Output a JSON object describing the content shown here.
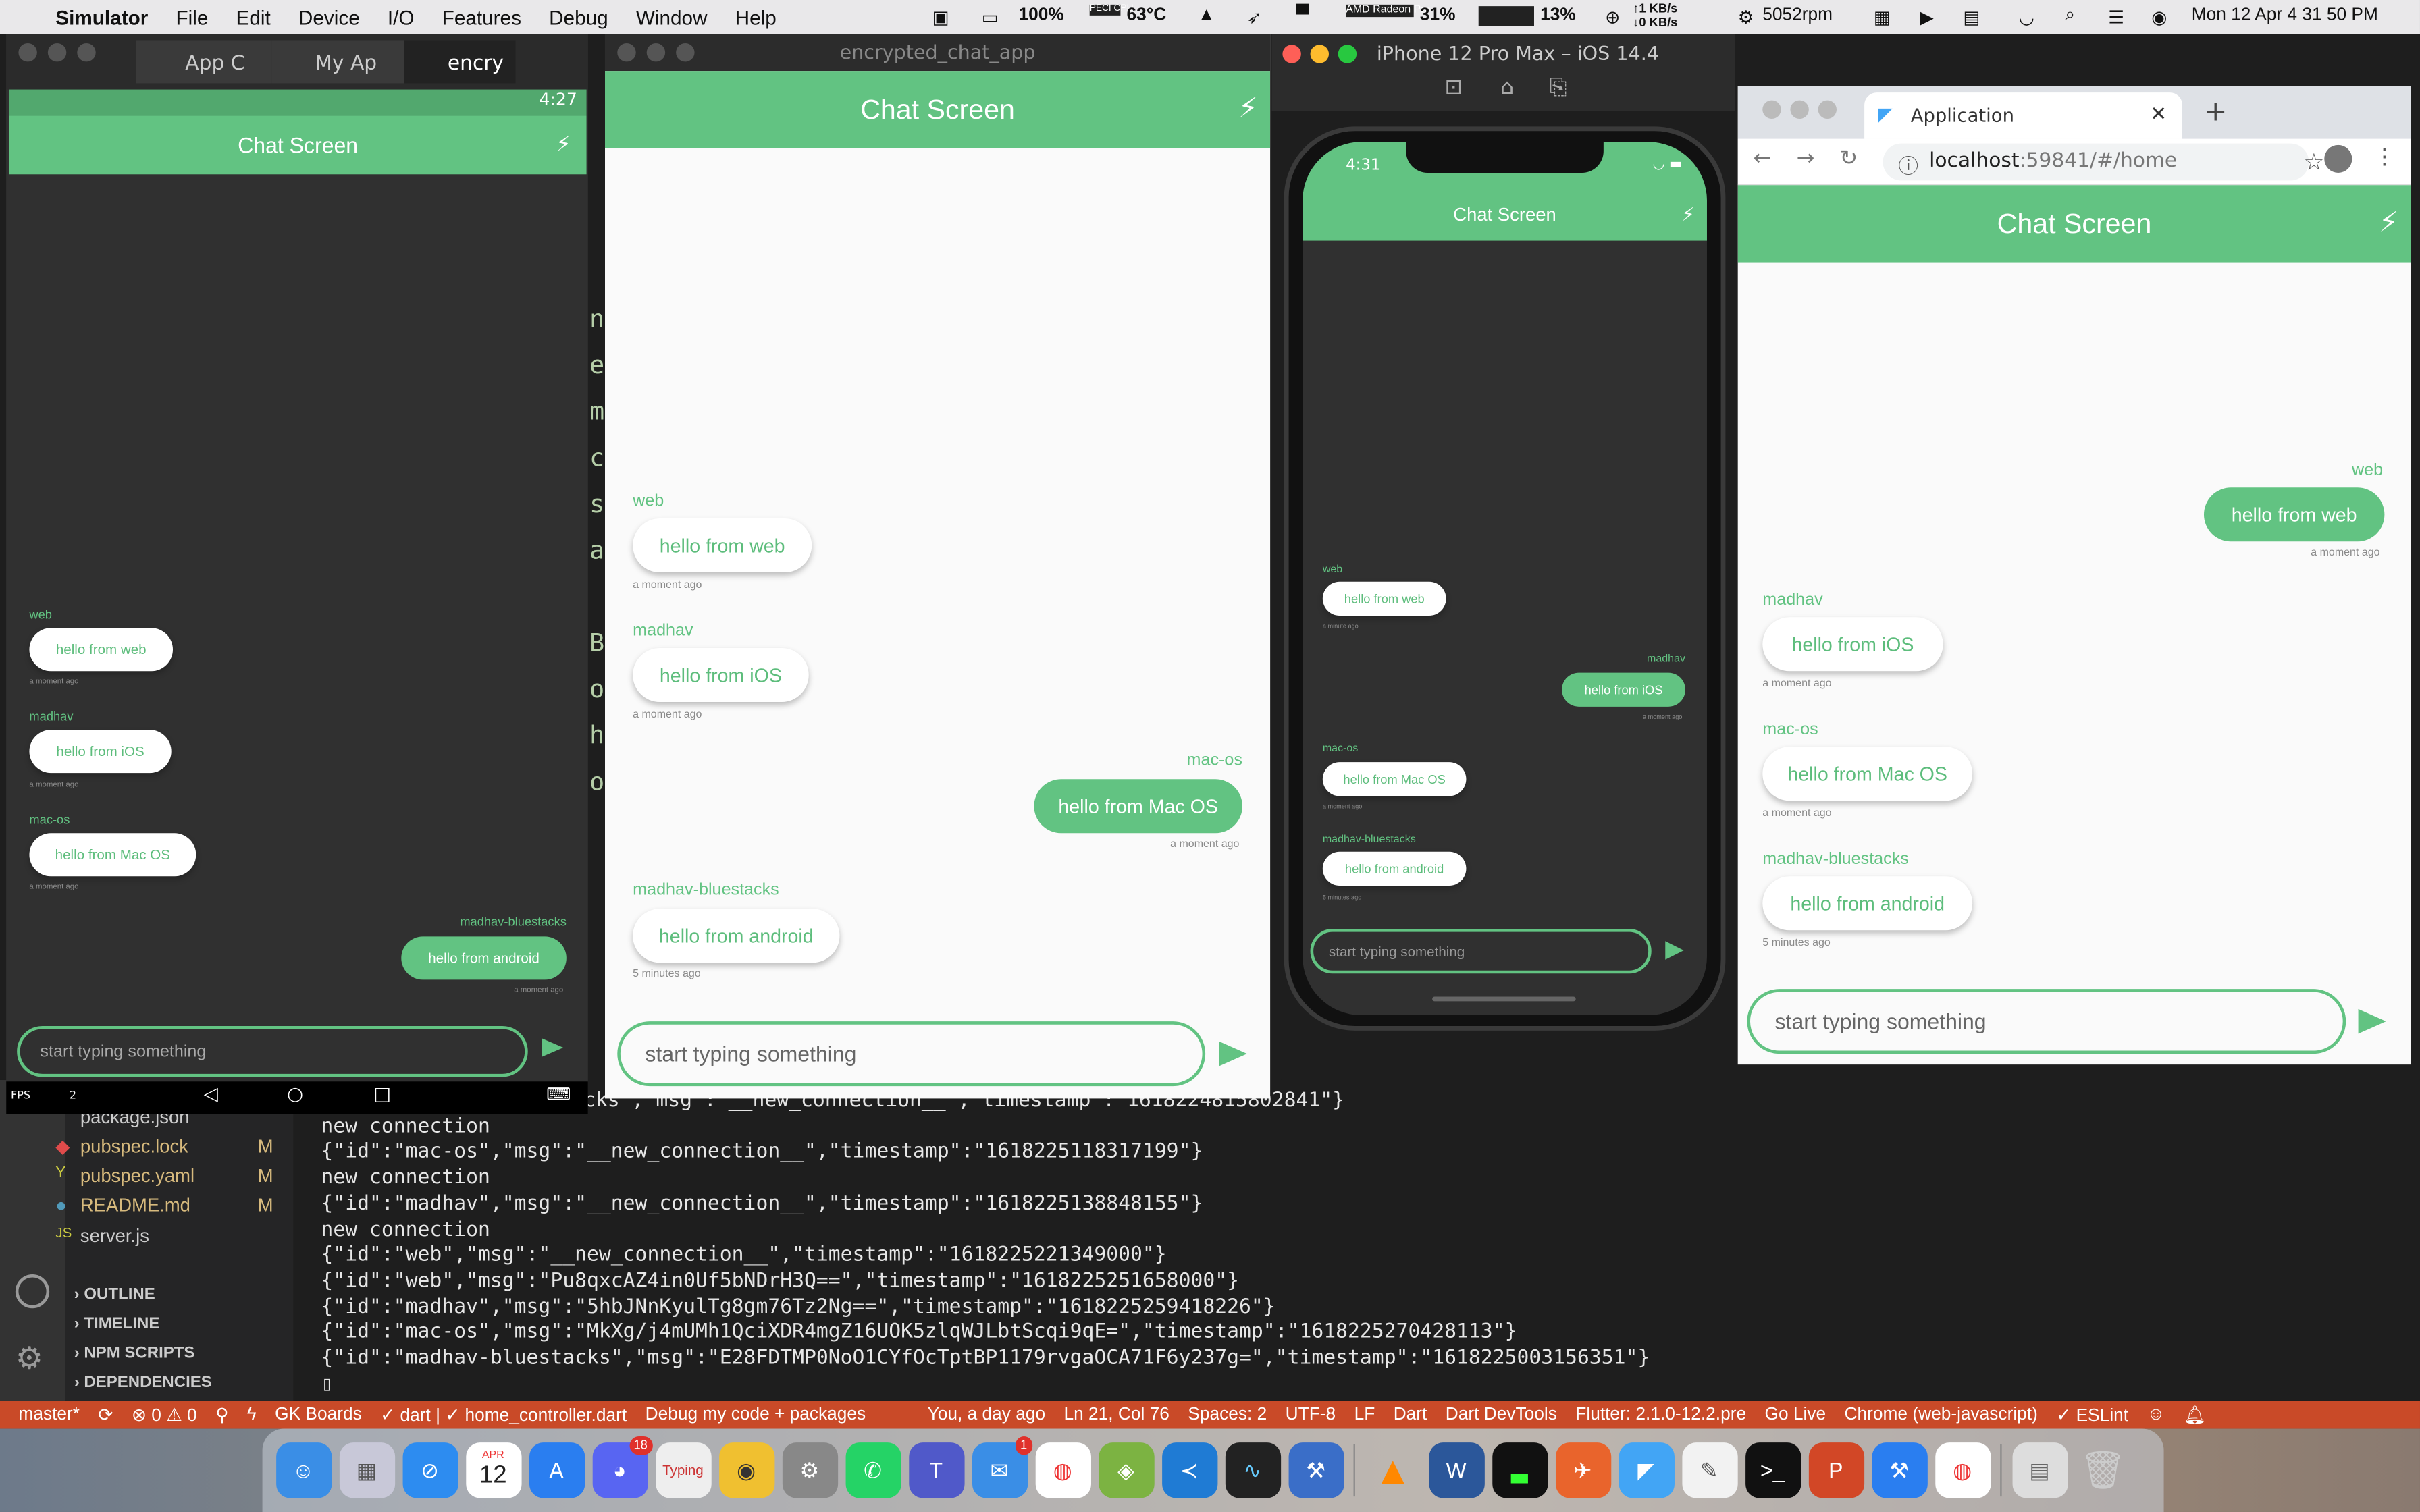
{
  "menubar": {
    "items": [
      "Simulator",
      "File",
      "Edit",
      "Device",
      "I/O",
      "Features",
      "Debug",
      "Window",
      "Help"
    ],
    "status": {
      "battery": "100%",
      "cpu_temp": "63°C",
      "gpu": "31%",
      "mem": "13%",
      "net_up": "↑1 KB/s",
      "net_down": "↓0 KB/s",
      "fan": "5052rpm",
      "datetime": "Mon 12 Apr  4 31 50 PM",
      "cpu_label": "PECI CPU",
      "gpu_label": "AMD Radeon Pro"
    }
  },
  "chat_title": "Chat Screen",
  "input_placeholder": "start typing something",
  "android": {
    "tabs": [
      "App C",
      "My Ap",
      "encry"
    ],
    "time": "4:27",
    "fps": "FPS",
    "fps_val": "2",
    "messages": [
      {
        "sender": "web",
        "text": "hello from web",
        "time": "a moment ago"
      },
      {
        "sender": "madhav",
        "text": "hello from iOS",
        "time": "a moment ago"
      },
      {
        "sender": "mac-os",
        "text": "hello from Mac OS",
        "time": "a moment ago"
      },
      {
        "sender": "madhav-bluestacks",
        "text": "hello from android",
        "time": "a moment ago"
      }
    ]
  },
  "macapp": {
    "title": "encrypted_chat_app",
    "messages": [
      {
        "sender": "web",
        "text": "hello from web",
        "time": "a moment ago"
      },
      {
        "sender": "madhav",
        "text": "hello from iOS",
        "time": "a moment ago"
      },
      {
        "sender": "mac-os",
        "text": "hello from Mac OS",
        "time": "a moment ago"
      },
      {
        "sender": "madhav-bluestacks",
        "text": "hello from android",
        "time": "5 minutes ago"
      }
    ]
  },
  "ios": {
    "title": "iPhone 12 Pro Max – iOS 14.4",
    "time": "4:31",
    "messages": [
      {
        "sender": "web",
        "text": "hello from web",
        "time": "a minute ago"
      },
      {
        "sender": "madhav",
        "text": "hello from iOS",
        "time": "a moment ago"
      },
      {
        "sender": "mac-os",
        "text": "hello from Mac OS",
        "time": "a moment ago"
      },
      {
        "sender": "madhav-bluestacks",
        "text": "hello from android",
        "time": "5 minutes ago"
      }
    ]
  },
  "chrome": {
    "tab": "Application",
    "url_host": "localhost",
    "url_rest": ":59841/#/home",
    "messages": [
      {
        "sender": "web",
        "text": "hello from web",
        "time": "a moment ago"
      },
      {
        "sender": "madhav",
        "text": "hello from iOS",
        "time": "a moment ago"
      },
      {
        "sender": "mac-os",
        "text": "hello from Mac OS",
        "time": "a moment ago"
      },
      {
        "sender": "madhav-bluestacks",
        "text": "hello from android",
        "time": "5 minutes ago"
      }
    ]
  },
  "vscode": {
    "files": [
      {
        "name": "package.json",
        "mod": ""
      },
      {
        "name": "pubspec.lock",
        "mod": "M"
      },
      {
        "name": "pubspec.yaml",
        "mod": "M"
      },
      {
        "name": "README.md",
        "mod": "M"
      },
      {
        "name": "server.js",
        "mod": ""
      }
    ],
    "sections": [
      "OUTLINE",
      "TIMELINE",
      "NPM SCRIPTS",
      "DEPENDENCIES"
    ],
    "terminal": [
      "cks\",\"msg\":\"__new_connection__\",\"timestamp\":\"1618224815802841\"}",
      "new connection",
      "{\"id\":\"mac-os\",\"msg\":\"__new_connection__\",\"timestamp\":\"1618225118317199\"}",
      "new connection",
      "{\"id\":\"madhav\",\"msg\":\"__new_connection__\",\"timestamp\":\"1618225138848155\"}",
      "new connection",
      "{\"id\":\"web\",\"msg\":\"__new_connection__\",\"timestamp\":\"1618225221349000\"}",
      "{\"id\":\"web\",\"msg\":\"Pu8qxcAZ4in0Uf5bNDrH3Q==\",\"timestamp\":\"1618225251658000\"}",
      "{\"id\":\"madhav\",\"msg\":\"5hbJNnKyulTg8gm76Tz2Ng==\",\"timestamp\":\"1618225259418226\"}",
      "{\"id\":\"mac-os\",\"msg\":\"MkXg/j4mUMh1QciXDR4mgZ16UOK5zlqWJLbtScqi9qE=\",\"timestamp\":\"1618225270428113\"}",
      "{\"id\":\"madhav-bluestacks\",\"msg\":\"E28FDTMP0NoO1CYfOcTptBP1179rvgaOCA71F6y237g=\",\"timestamp\":\"1618225003156351\"}"
    ],
    "code_chars": [
      "n",
      "e",
      "m",
      "c",
      "s",
      "a",
      "B",
      "o",
      "h",
      "o"
    ],
    "status": {
      "branch": "master*",
      "errors": "⊗ 0 ⚠ 0",
      "gk": "GK Boards",
      "dart_file": "✓ dart | ✓ home_controller.dart",
      "debug": "Debug my code + packages",
      "blame": "You, a day ago",
      "pos": "Ln 21, Col 76",
      "spaces": "Spaces: 2",
      "enc": "UTF-8",
      "eol": "LF",
      "lang": "Dart",
      "devtools": "Dart DevTools",
      "flutter": "Flutter: 2.1.0-12.2.pre",
      "golive": "Go Live",
      "chrome": "Chrome (web-javascript)",
      "eslint": "✓ ESLint"
    }
  },
  "dock": {
    "calendar_month": "APR",
    "calendar_day": "12",
    "badge_discord": "18",
    "badge_mail": "1",
    "typing_label": "Typing"
  },
  "colors": {
    "accent": "#62c382",
    "dark_bg": "#303030",
    "light_bg": "#fafafa"
  }
}
